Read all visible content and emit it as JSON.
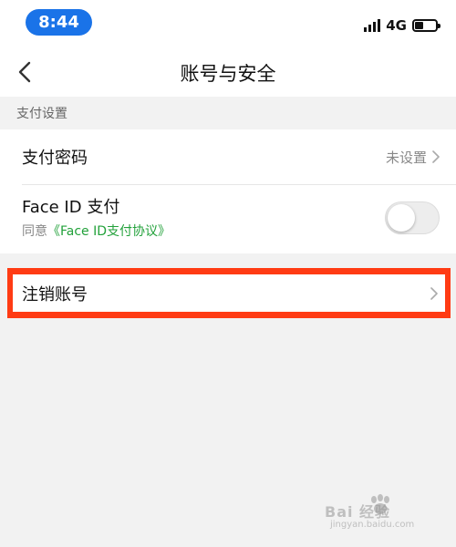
{
  "status_bar": {
    "time": "8:44",
    "network": "4G",
    "battery_level": 0.3,
    "time_pill_color": "#1a73e8"
  },
  "nav": {
    "title": "账号与安全",
    "back_icon": "chevron-left-icon"
  },
  "section": {
    "header": "支付设置"
  },
  "rows": {
    "pay_password": {
      "label": "支付密码",
      "value": "未设置"
    },
    "face_id": {
      "label": "Face ID 支付",
      "agree_prefix": "同意",
      "agreement_link": "《Face ID支付协议》",
      "enabled": false,
      "link_color": "#22a13a"
    },
    "cancel_account": {
      "label": "注销账号",
      "highlight_color": "#ff3b14"
    }
  },
  "watermark": {
    "main": "Bai 经验",
    "sub": "jingyan.baidu.com"
  }
}
